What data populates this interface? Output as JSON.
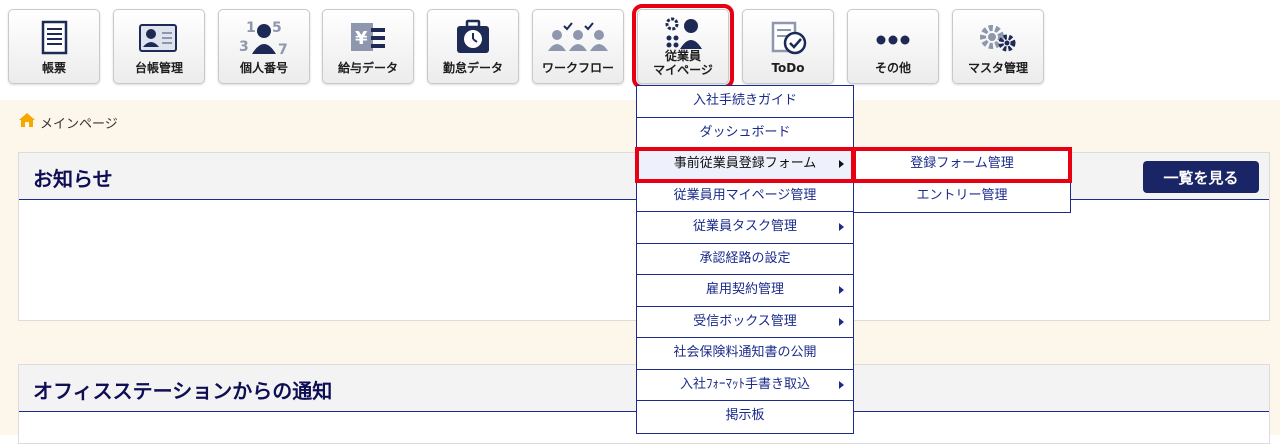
{
  "toolbar": {
    "items": [
      {
        "label": "帳票",
        "icon": "document-list-icon"
      },
      {
        "label": "台帳管理",
        "icon": "id-card-icon"
      },
      {
        "label": "個人番号",
        "icon": "person-number-icon"
      },
      {
        "label": "給与データ",
        "icon": "salary-yen-icon"
      },
      {
        "label": "勤怠データ",
        "icon": "clock-bag-icon"
      },
      {
        "label": "ワークフロー",
        "icon": "workflow-people-icon"
      },
      {
        "label_line1": "従業員",
        "label_line2": "マイページ",
        "icon": "employee-gear-icon"
      },
      {
        "label": "ToDo",
        "icon": "todo-check-icon"
      },
      {
        "label": "その他",
        "icon": "more-dots-icon"
      },
      {
        "label": "マスタ管理",
        "icon": "gears-icon"
      }
    ]
  },
  "breadcrumb": {
    "label": "メインページ"
  },
  "notice_panel": {
    "title": "お知らせ",
    "button": "一覧を見る"
  },
  "office_panel": {
    "title": "オフィスステーションからの通知"
  },
  "menu": {
    "items": [
      {
        "label": "入社手続きガイド"
      },
      {
        "label": "ダッシュボード"
      },
      {
        "label": "事前従業員登録フォーム"
      },
      {
        "label": "従業員用マイページ管理"
      },
      {
        "label": "従業員タスク管理"
      },
      {
        "label": "承認経路の設定"
      },
      {
        "label": "雇用契約管理"
      },
      {
        "label": "受信ボックス管理"
      },
      {
        "label": "社会保険料通知書の公開"
      },
      {
        "label": "入社ﾌｫｰﾏｯﾄ手書き取込"
      },
      {
        "label": "掲示板"
      }
    ]
  },
  "submenu": {
    "items": [
      {
        "label": "登録フォーム管理"
      },
      {
        "label": "エントリー管理"
      }
    ]
  },
  "colors": {
    "accent": "#1a2566",
    "highlight": "#e60012",
    "page_bg": "#fdf6ea",
    "menu_border": "#1a2b8a"
  }
}
